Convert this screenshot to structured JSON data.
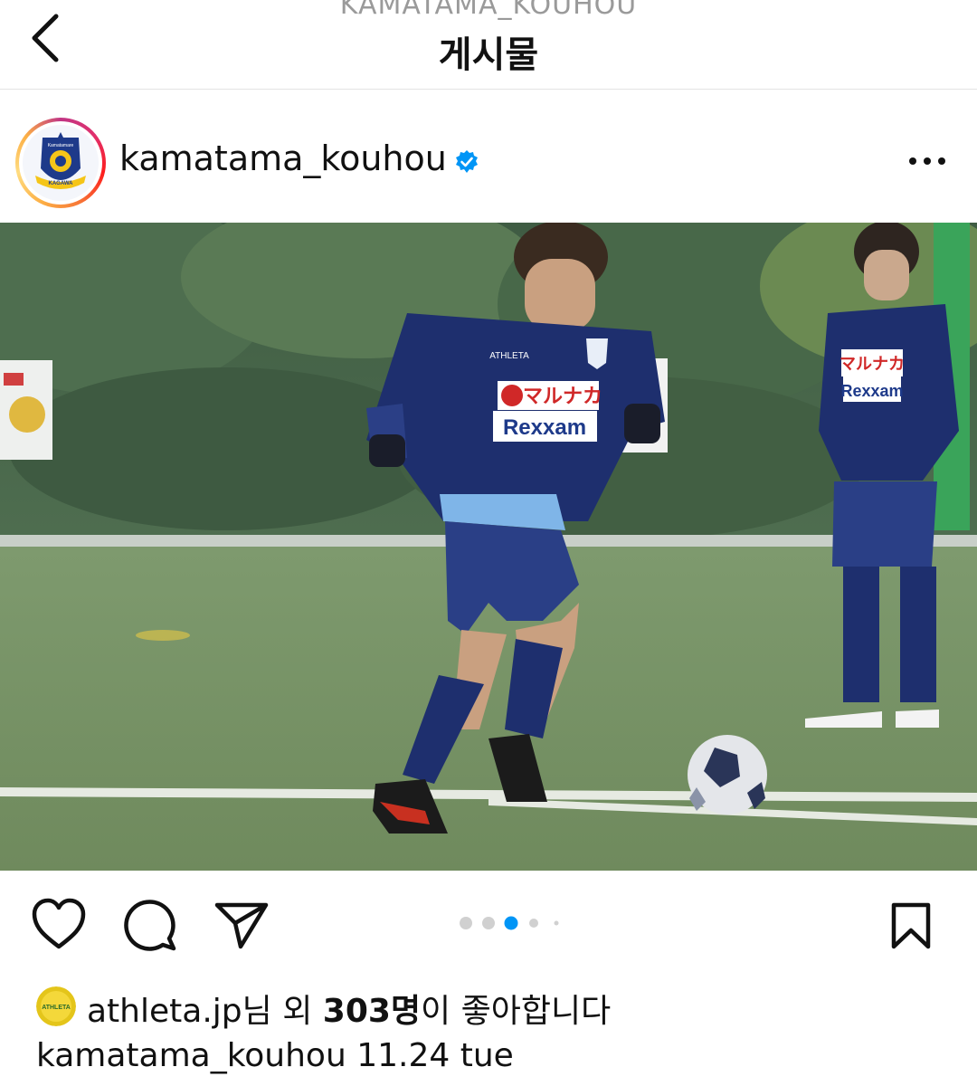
{
  "header": {
    "subtitle": "KAMATAMA_KOUHOU",
    "title": "게시물"
  },
  "post": {
    "username": "kamatama_kouhou",
    "verified": true,
    "avatar_text": {
      "top": "Kamatamare",
      "bottom": "KAGAWA"
    },
    "photo": {
      "jersey_sponsor_1": "マルナカ",
      "jersey_sponsor_2": "Rexxam",
      "kit_brand": "ATHLETA"
    },
    "carousel": {
      "count": 5,
      "active_index": 2
    }
  },
  "likes": {
    "liker": "athleta.jp",
    "mid": "님 외 ",
    "count": "303명",
    "tail": "이 좋아합니다",
    "liker_avatar_text": "ATHLETA"
  },
  "caption": {
    "username": "kamatama_kouhou",
    "text": " 11.24 tue"
  },
  "icons": {
    "back": "chevron-left-icon",
    "more": "more-horizontal-icon",
    "like": "heart-icon",
    "comment": "comment-icon",
    "share": "send-icon",
    "save": "bookmark-icon",
    "verified": "verified-badge-icon"
  },
  "colors": {
    "verified": "#0095f6",
    "active_dot": "#0095f6",
    "inactive_dot": "#d0d0d0"
  }
}
